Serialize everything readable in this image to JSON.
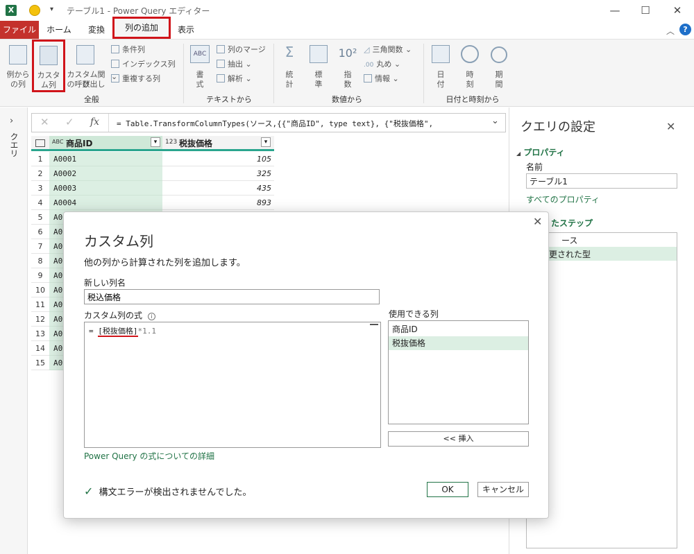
{
  "window": {
    "title": "テーブル1 - Power Query エディター",
    "minimize": "—",
    "maximize": "☐",
    "close": "✕"
  },
  "tabs": {
    "file": "ファイル",
    "home": "ホーム",
    "transform": "変換",
    "add_column": "列の追加",
    "view": "表示"
  },
  "ribbon": {
    "example_col": [
      "例から",
      "の列"
    ],
    "custom_col": [
      "カスタ",
      "ム列"
    ],
    "invoke_fn": [
      "カスタム関数",
      "の呼び出し"
    ],
    "conditional": "条件列",
    "index": "インデックス列",
    "duplicate": "重複する列",
    "group_general": "全般",
    "format": [
      "書",
      "式"
    ],
    "merge": "列のマージ",
    "extract": "抽出",
    "parse": "解析",
    "group_text": "テキストから",
    "stats": [
      "統",
      "計"
    ],
    "standard": [
      "標",
      "準"
    ],
    "scientific": [
      "指",
      "数"
    ],
    "trig": "三角関数",
    "round": "丸め",
    "info": "情報",
    "group_number": "数値から",
    "date": [
      "日",
      "付"
    ],
    "time": [
      "時",
      "刻"
    ],
    "duration": [
      "期",
      "間"
    ],
    "group_datetime": "日付と時刻から"
  },
  "left_strip": {
    "label": "クエリ"
  },
  "formula": {
    "text": "= Table.TransformColumnTypes(ソース,{{\"商品ID\", type text}, {\"税抜価格\",",
    "fx": "fx"
  },
  "grid": {
    "col1_type": "ABC",
    "col1_name": "商品ID",
    "col2_type": "123",
    "col2_name": "税抜価格",
    "rows": [
      {
        "n": "1",
        "id": "A0001",
        "val": "105"
      },
      {
        "n": "2",
        "id": "A0002",
        "val": "325"
      },
      {
        "n": "3",
        "id": "A0003",
        "val": "435"
      },
      {
        "n": "4",
        "id": "A0004",
        "val": "893"
      },
      {
        "n": "5",
        "id": "A0",
        "val": ""
      },
      {
        "n": "6",
        "id": "A0",
        "val": ""
      },
      {
        "n": "7",
        "id": "A0",
        "val": ""
      },
      {
        "n": "8",
        "id": "A0",
        "val": ""
      },
      {
        "n": "9",
        "id": "A0",
        "val": ""
      },
      {
        "n": "10",
        "id": "A0",
        "val": ""
      },
      {
        "n": "11",
        "id": "A0",
        "val": ""
      },
      {
        "n": "12",
        "id": "A0",
        "val": ""
      },
      {
        "n": "13",
        "id": "A0",
        "val": ""
      },
      {
        "n": "14",
        "id": "A0",
        "val": ""
      },
      {
        "n": "15",
        "id": "A0",
        "val": ""
      }
    ]
  },
  "settings": {
    "title": "クエリの設定",
    "properties": "プロパティ",
    "name_label": "名前",
    "name_value": "テーブル1",
    "all_props": "すべてのプロパティ",
    "steps_title": "たステップ",
    "steps": [
      "ース",
      "更された型"
    ]
  },
  "dialog": {
    "title": "カスタム列",
    "description": "他の列から計算された列を追加します。",
    "new_col_label": "新しい列名",
    "new_col_value": "税込価格",
    "formula_label": "カスタム列の式",
    "formula_prefix": "= ",
    "formula_ref": "[税抜価格]",
    "formula_rest": "*1.1",
    "available_label": "使用できる列",
    "available": [
      "商品ID",
      "税抜価格"
    ],
    "insert": "<< 挿入",
    "learn_more": "Power Query の式についての詳細",
    "status": "構文エラーが検出されませんでした。",
    "ok": "OK",
    "cancel": "キャンセル"
  },
  "colors": {
    "accent_green": "#217346",
    "highlight": "#d0141a",
    "file_tab": "#c4312c",
    "selected_row": "#dcefe3"
  }
}
